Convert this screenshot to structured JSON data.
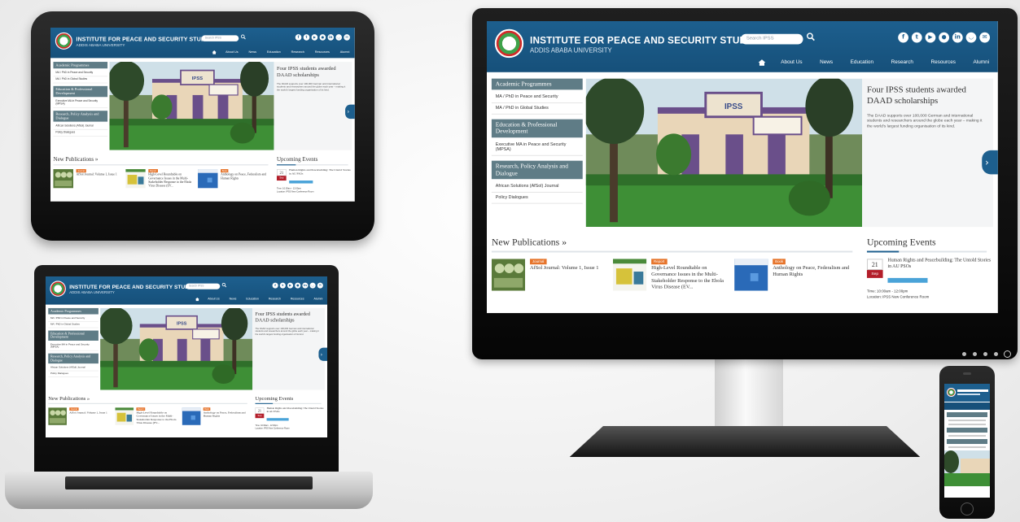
{
  "site": {
    "title": "INSTITUTE FOR PEACE AND SECURITY STUDIES",
    "subtitle": "ADDIS ABABA UNIVERSITY",
    "search_placeholder": "Search IPSS",
    "social_icons": [
      "facebook-icon",
      "twitter-icon",
      "youtube-icon",
      "flickr-icon",
      "linkedin-icon",
      "rss-icon",
      "email-icon"
    ],
    "nav": [
      "About Us",
      "News",
      "Education",
      "Research",
      "Resources",
      "Alumni"
    ],
    "sidebar": [
      {
        "heading": "Academic Programmes",
        "links": [
          "MA / PhD in Peace and Security",
          "MA / PhD in Global Studies"
        ]
      },
      {
        "heading": "Education & Professional Development",
        "links": [
          "Executive MA in Peace and Security (MPSA)"
        ]
      },
      {
        "heading": "Research, Policy Analysis and Dialogue",
        "links": [
          "African Solutions (AfSol) Journal",
          "Policy Dialogues"
        ]
      }
    ],
    "feature": {
      "title": "Four IPSS students awarded DAAD scholarships",
      "body": "The DAAD supports over 100,000 German and international students and researchers around the globe each year – making it the world's largest funding organisation of its kind."
    },
    "publications_title": "New Publications »",
    "publications": [
      {
        "tag": "Journal",
        "title": "AfSol Journal: Volume 1, Issue 1"
      },
      {
        "tag": "Report",
        "title": "High-Level Roundtable on Governance Issues in the Multi-Stakeholder Response to the Ebola Virus Disease (EV..."
      },
      {
        "tag": "Book",
        "title": "Anthology on Peace, Federalism and Human Rights"
      }
    ],
    "events_title": "Upcoming Events",
    "event": {
      "day": "21",
      "month": "Sep",
      "title": "Human Rights and Peacebuilding: The Untold Stories in AU PSOs",
      "time": "Time: 10:00am - 12:00pm",
      "location": "Location: IPSS New Conference Room"
    }
  },
  "colors": {
    "header": "#1d5f8e",
    "sidebar_heading": "#5f7c86",
    "tag": "#e6742b",
    "event_month": "#b31e2a"
  }
}
